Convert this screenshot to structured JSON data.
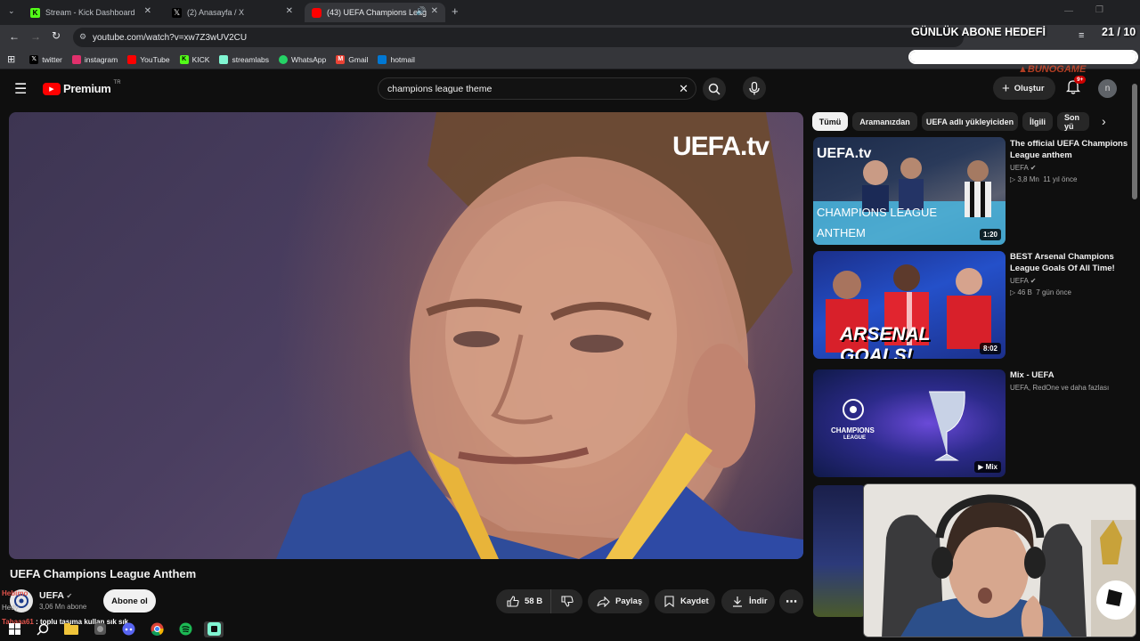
{
  "browser": {
    "tabs": [
      {
        "label": "Stream - Kick Dashboard",
        "icon": "kick-icon",
        "active": false
      },
      {
        "label": "(2) Anasayfa / X",
        "icon": "x-icon",
        "active": false
      },
      {
        "label": "(43) UEFA Champions Leag",
        "icon": "youtube-icon",
        "active": true
      }
    ],
    "new_tab": "+",
    "url": "youtube.com/watch?v=xw7Z3wUV2CU",
    "bookmarks": [
      {
        "label": "twitter",
        "icon": "x-icon",
        "color": "#ffffff"
      },
      {
        "label": "instagram",
        "icon": "instagram-icon",
        "color": "#e1306c"
      },
      {
        "label": "YouTube",
        "icon": "youtube-icon",
        "color": "#ff0000"
      },
      {
        "label": "KICK",
        "icon": "kick-icon",
        "color": "#53fc18"
      },
      {
        "label": "streamlabs",
        "icon": "streamlabs-icon",
        "color": "#80f5d2"
      },
      {
        "label": "WhatsApp",
        "icon": "whatsapp-icon",
        "color": "#25d366"
      },
      {
        "label": "Gmail",
        "icon": "gmail-icon",
        "color": "#ea4335"
      },
      {
        "label": "hotmail",
        "icon": "outlook-icon",
        "color": "#0078d4"
      }
    ]
  },
  "youtube": {
    "logo_text": "Premium",
    "country_code": "TR",
    "search_value": "champions league theme",
    "create_label": "Oluştur",
    "notif_count": "9+",
    "avatar_letter": "n",
    "video_watermark": "UEFA.tv",
    "video_title": "UEFA Champions League Anthem",
    "channel": {
      "name": "UEFA",
      "subs": "3,06 Mn abone",
      "subscribe_label": "Abone ol"
    },
    "actions": {
      "like_count": "58 B",
      "share": "Paylaş",
      "save": "Kaydet",
      "download": "İndir"
    },
    "chips": [
      "Tümü",
      "Aramanızdan",
      "UEFA adlı yükleyiciden",
      "İlgili",
      "Son yü"
    ],
    "recommendations": [
      {
        "title": "The official UEFA Champions League anthem",
        "channel": "UEFA",
        "views": "3,8 Mn",
        "age": "11 yıl önce",
        "duration": "1:20",
        "thumb_text_1": "UEFA.tv",
        "thumb_text_2": "CHAMPIONS LEAGUE",
        "thumb_text_3": "ANTHEM"
      },
      {
        "title": "BEST Arsenal Champions League Goals Of All Time!",
        "channel": "UEFA",
        "views": "46 B",
        "age": "7 gün önce",
        "duration": "8:02",
        "thumb_text_1": "ARSENAL GOALS!"
      },
      {
        "title": "Mix - UEFA",
        "channel": "UEFA, RedOne ve daha fazlası",
        "duration": "Mix",
        "thumb_text_1": "CHAMPIONS",
        "thumb_text_2": "LEAGUE"
      }
    ]
  },
  "stream_overlay": {
    "goal_label": "GÜNLÜK ABONE HEDEFİ",
    "goal_count": "21 / 10",
    "goal_progress": 1.0,
    "watermark": "BUNOGAME",
    "chat": [
      {
        "user": "Hebimo",
        "text": "UEFA"
      },
      {
        "user": "Hedy",
        "text": ""
      },
      {
        "user": "Tahaaa61",
        "text": "toplu taşıma kullan sık sık"
      }
    ]
  },
  "taskbar": {
    "items": [
      "windows-start-icon",
      "search-icon",
      "file-explorer-icon",
      "app-icon",
      "discord-icon",
      "chrome-icon",
      "spotify-icon",
      "streamlabs-icon"
    ]
  }
}
